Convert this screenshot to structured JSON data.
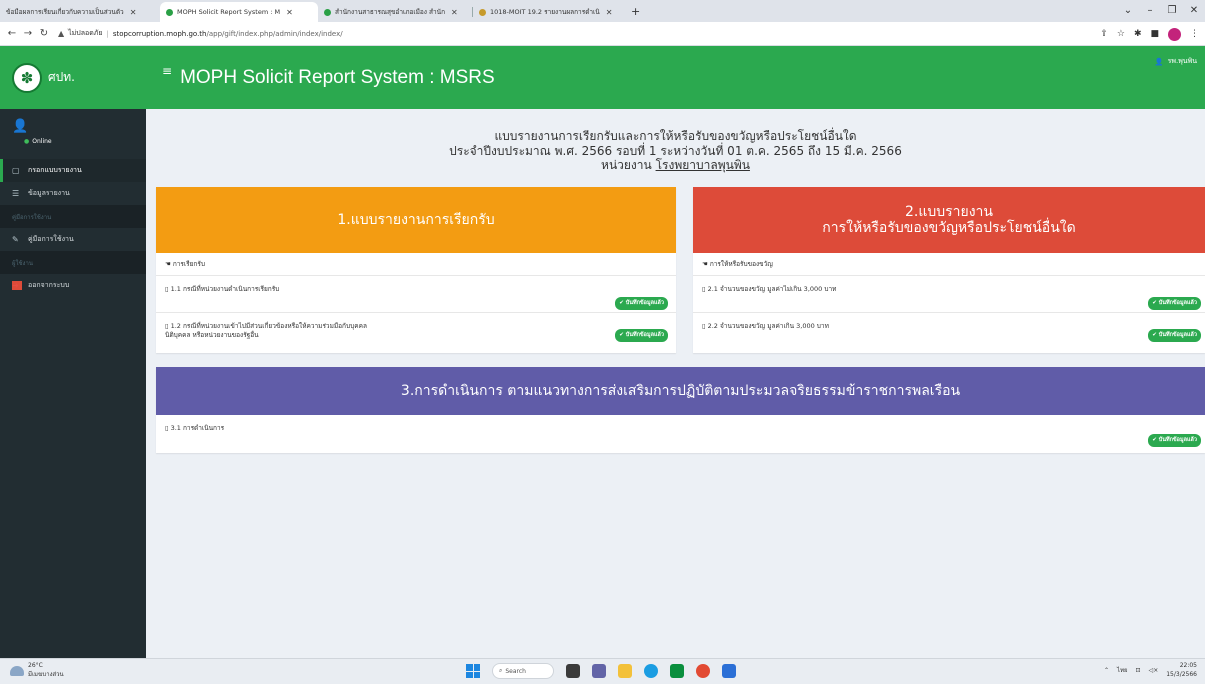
{
  "browser": {
    "tabs": [
      {
        "label": "ข้อมือผลการเรียนเกี่ยวกับความเป็นส่วนตัว",
        "active": false
      },
      {
        "label": "MOPH Solicit Report System : M",
        "active": true
      },
      {
        "label": "สำนักงานสาธารณสุขอำเภอเมือง สำนัก",
        "active": false
      },
      {
        "label": "1018-MOIT 19.2 รายงานผลการดำเนิ",
        "active": false
      }
    ],
    "new_tab": "+",
    "security_label": "ไม่ปลอดภัย",
    "url_host": "stopcorruption.moph.go.th",
    "url_path": "/app/gift/index.php/admin/index/index/"
  },
  "sidebar": {
    "brand": "ศปท.",
    "status": "Online",
    "items": [
      {
        "label": "กรอกแบบรายงาน",
        "type": "item",
        "active": true,
        "icon": "file-icon"
      },
      {
        "label": "ข้อมูลรายงาน",
        "type": "item",
        "active": false,
        "icon": "list-icon"
      },
      {
        "label": "คู่มือการใช้งาน",
        "type": "header"
      },
      {
        "label": "คู่มือการใช้งาน",
        "type": "item",
        "active": false,
        "icon": "book-icon"
      },
      {
        "label": "ผู้ใช้งาน",
        "type": "header"
      },
      {
        "label": "ออกจากระบบ",
        "type": "item",
        "active": false,
        "icon": "logout-icon"
      }
    ]
  },
  "header": {
    "title": "MOPH Solicit Report System : MSRS",
    "user": "รพ.พุนพิน"
  },
  "report": {
    "title": "แบบรายงานการเรียกรับและการให้หรือรับของขวัญหรือประโยชน์อื่นใด",
    "period": "ประจำปีงบประมาณ พ.ศ. 2566 รอบที่ 1 ระหว่างวันที่ 01 ต.ค. 2565 ถึง 15 มี.ค. 2566",
    "unit_prefix": "หน่วยงาน",
    "unit_name": "โรงพยาบาลพุนพิน"
  },
  "cards": {
    "c1": {
      "title": "1.แบบรายงานการเรียกรับ",
      "subtitle": "การเรียกรับ",
      "rows": [
        {
          "label": "1.1 กรณีที่หน่วยงานดำเนินการเรียกรับ",
          "status": "บันทึกข้อมูลแล้ว"
        },
        {
          "label": "1.2 กรณีที่หน่วยงานเข้าไปมีส่วนเกี่ยวข้องหรือให้ความร่วมมือกับบุคคล",
          "label2": "นิติบุคคล หรือหน่วยงานของรัฐอื่น",
          "status": "บันทึกข้อมูลแล้ว"
        }
      ]
    },
    "c2": {
      "title_line1": "2.แบบรายงาน",
      "title_line2": "การให้หรือรับของขวัญหรือประโยชน์อื่นใด",
      "subtitle": "การให้หรือรับของขวัญ",
      "rows": [
        {
          "label": "2.1 จำนวนของขวัญ มูลค่าไม่เกิน 3,000 บาท",
          "status": "บันทึกข้อมูลแล้ว"
        },
        {
          "label": "2.2 จำนวนของขวัญ มูลค่าเกิน 3,000 บาท",
          "status": "บันทึกข้อมูลแล้ว"
        }
      ]
    },
    "c3": {
      "title": "3.การดำเนินการ ตามแนวทางการส่งเสริมการปฏิบัติตามประมวลจริยธรรมข้าราชการพลเรือน",
      "rows": [
        {
          "label": "3.1 การดำเนินการ",
          "status": "บันทึกข้อมูลแล้ว"
        }
      ]
    }
  },
  "taskbar": {
    "temp": "26°C",
    "weather": "มีเมฆบางส่วน",
    "search": "Search",
    "lang": "ไทย",
    "time": "22:05",
    "date": "15/3/2566"
  }
}
